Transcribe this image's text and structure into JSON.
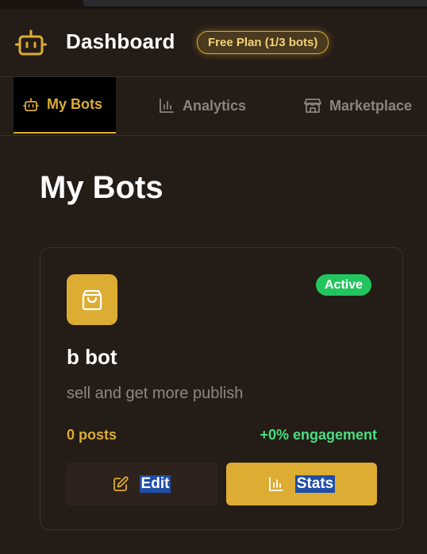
{
  "header": {
    "title": "Dashboard",
    "plan_badge": "Free Plan (1/3 bots)"
  },
  "tabs": [
    {
      "label": "My Bots",
      "icon": "robot-icon",
      "active": true
    },
    {
      "label": "Analytics",
      "icon": "bar-chart-icon",
      "active": false
    },
    {
      "label": "Marketplace",
      "icon": "store-icon",
      "active": false
    }
  ],
  "page": {
    "title": "My Bots"
  },
  "bots": [
    {
      "icon": "shopping-bag-icon",
      "status": "Active",
      "name": "b bot",
      "description": "sell and get more publish",
      "posts": "0 posts",
      "engagement": "+0% engagement",
      "edit_label": "Edit",
      "stats_label": "Stats"
    }
  ],
  "colors": {
    "accent": "#dcac33",
    "background": "#241c17",
    "status_active": "#22c55e",
    "engagement": "#4ade80"
  }
}
